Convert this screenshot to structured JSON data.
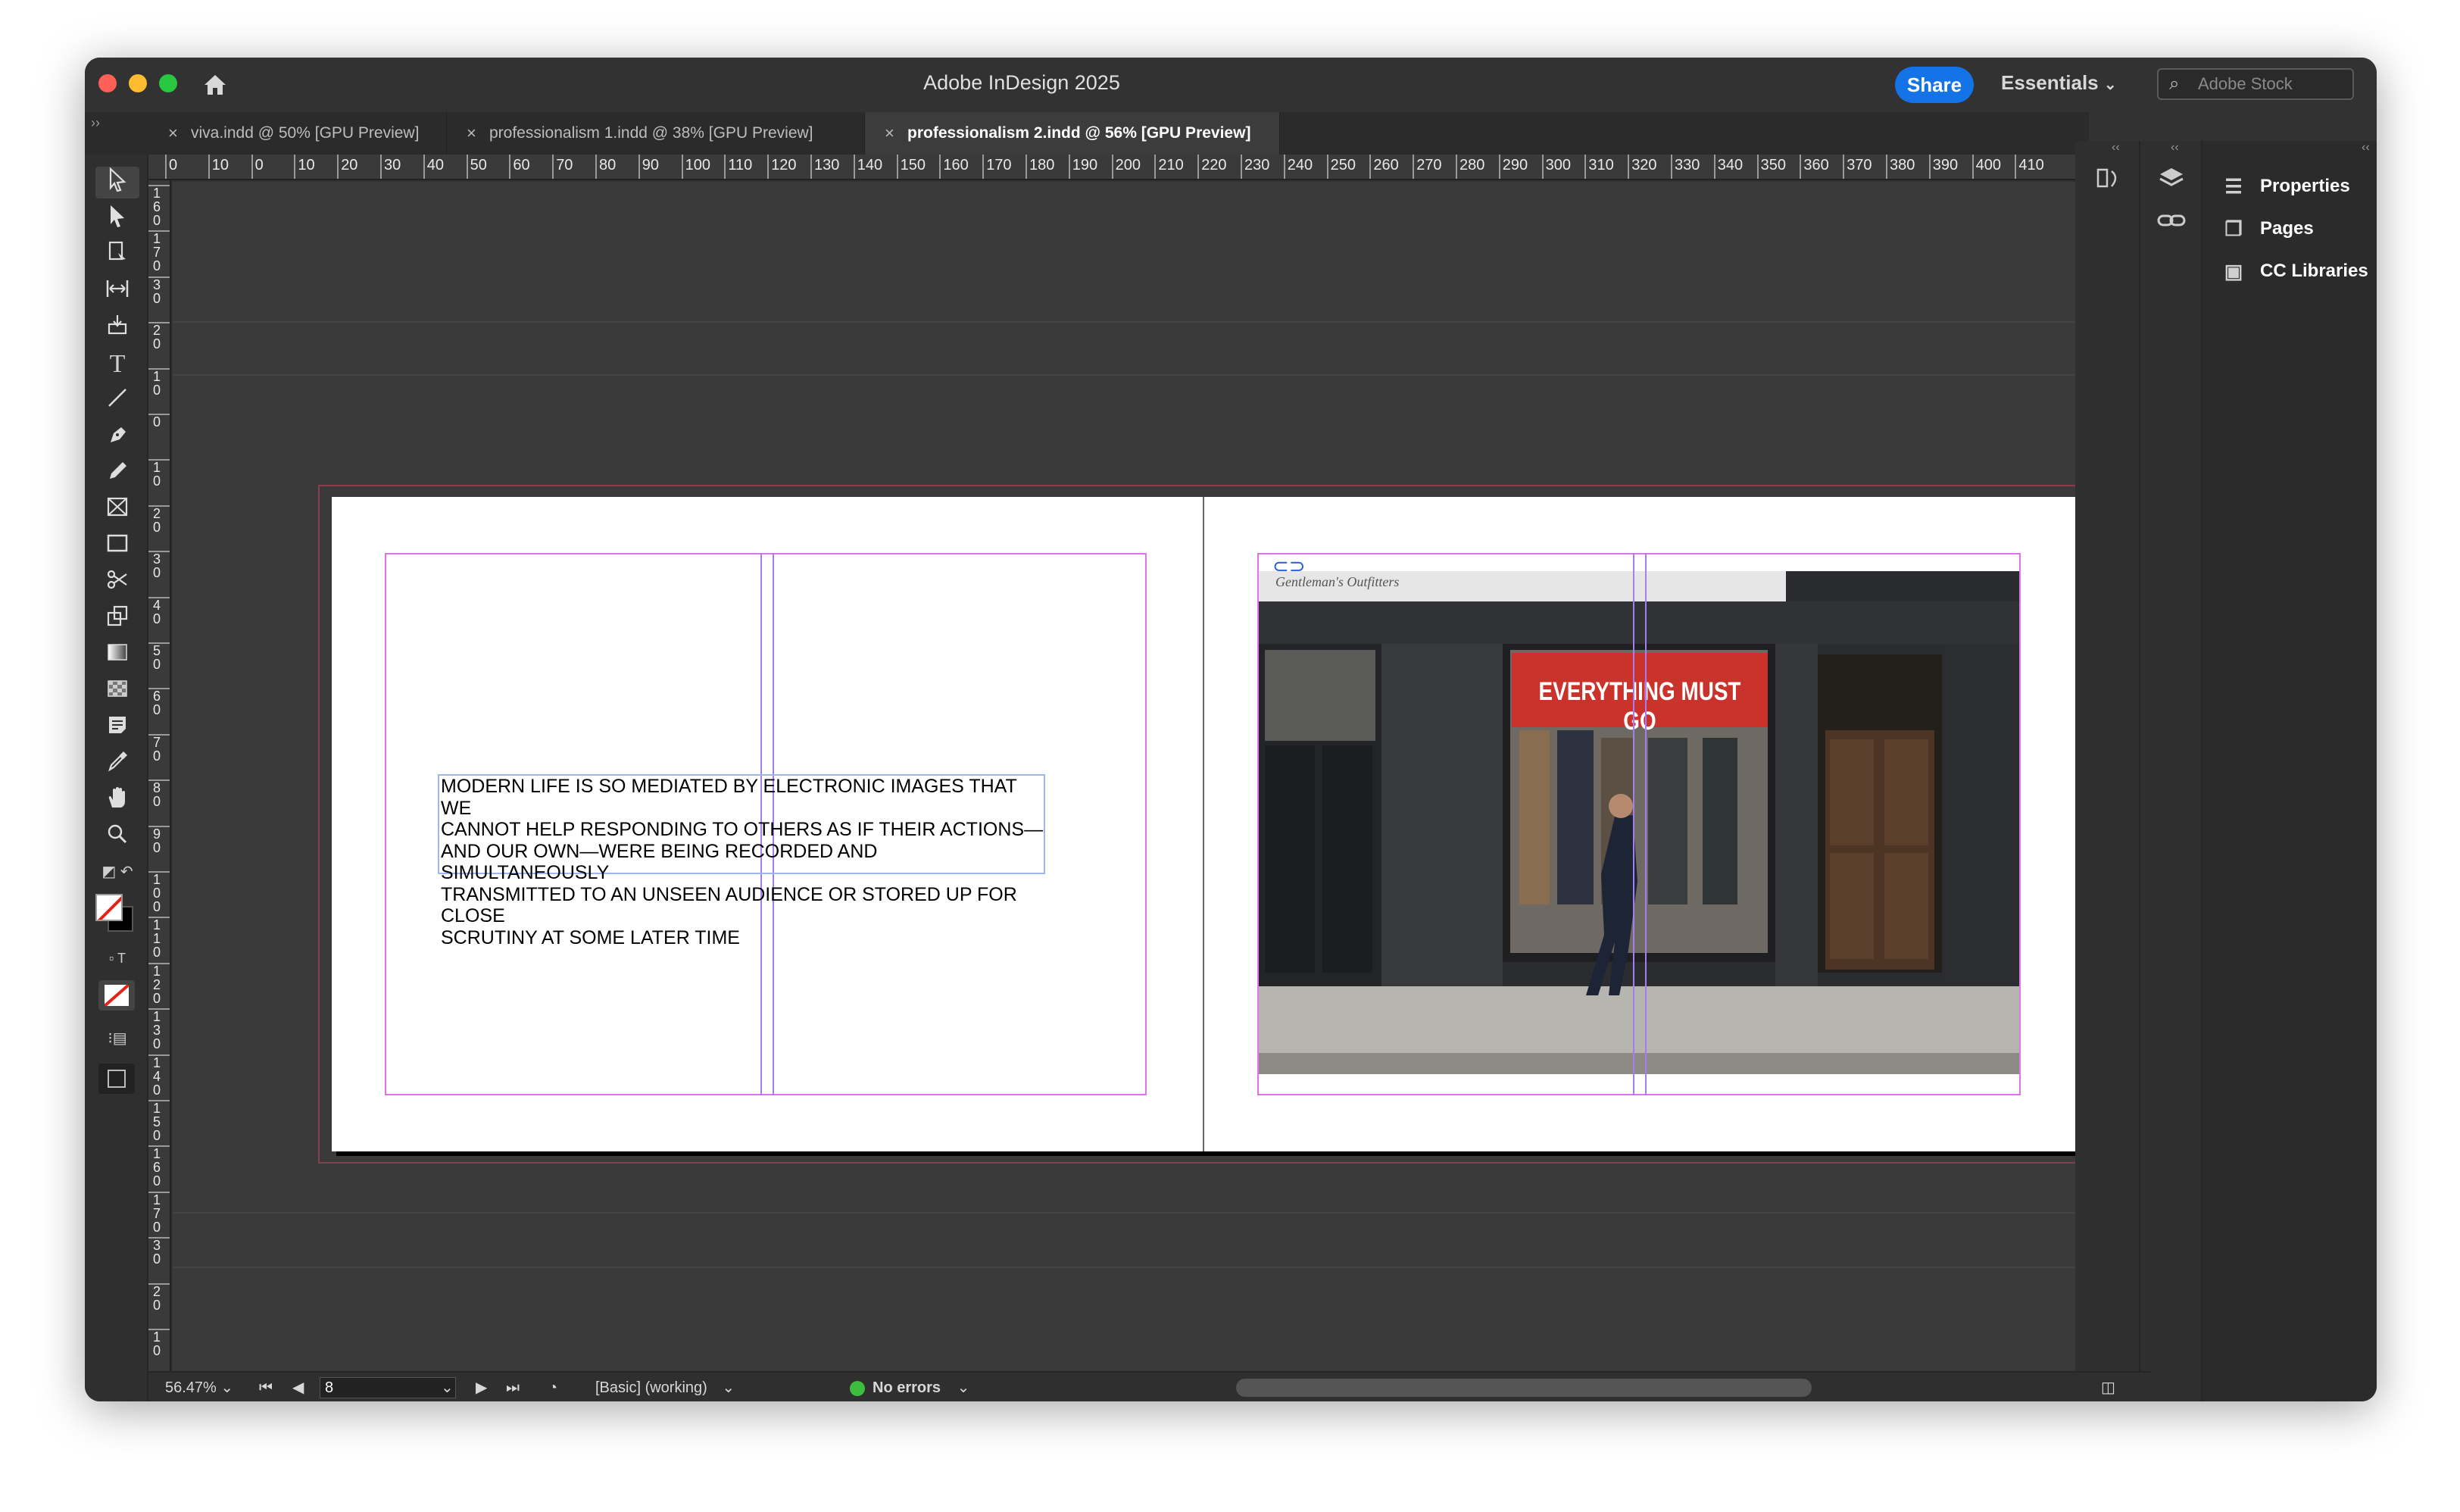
{
  "app": {
    "title": "Adobe InDesign 2025",
    "share_label": "Share",
    "workspace": "Essentials",
    "search_placeholder": "Adobe Stock"
  },
  "tabs": [
    {
      "label": "viva.indd @ 50% [GPU Preview]",
      "active": false
    },
    {
      "label": "professionalism 1.indd @ 38% [GPU Preview]",
      "active": false
    },
    {
      "label": "professionalism 2.indd @ 56% [GPU Preview]",
      "active": true
    }
  ],
  "tools": [
    "selection-tool",
    "direct-selection-tool",
    "page-tool",
    "gap-tool",
    "content-collector-tool",
    "type-tool",
    "line-tool",
    "pen-tool",
    "pencil-tool",
    "rectangle-frame-tool",
    "rectangle-tool",
    "scissors-tool",
    "free-transform-tool",
    "gradient-swatch-tool",
    "gradient-feather-tool",
    "note-tool",
    "eyedropper-tool",
    "hand-tool",
    "zoom-tool"
  ],
  "ruler": {
    "h_labels": [
      "0",
      "10",
      "0",
      "10",
      "20",
      "30",
      "40",
      "50",
      "60",
      "70",
      "80",
      "90",
      "100",
      "110",
      "120",
      "130",
      "140",
      "150",
      "160",
      "170",
      "180",
      "190",
      "200",
      "210",
      "220",
      "230",
      "240",
      "250",
      "260",
      "270",
      "280",
      "290",
      "300",
      "310",
      "320",
      "330",
      "340",
      "350",
      "360",
      "370",
      "380",
      "390",
      "400",
      "410"
    ],
    "v_labels": [
      "160",
      "170",
      "30",
      "20",
      "10",
      "0",
      "10",
      "20",
      "30",
      "40",
      "50",
      "60",
      "70",
      "80",
      "90",
      "100",
      "110",
      "120",
      "130",
      "140",
      "150",
      "160",
      "170",
      "30",
      "20",
      "10"
    ]
  },
  "document": {
    "body_text": "MODERN LIFE IS SO MEDIATED BY ELECTRONIC IMAGES THAT WE\nCANNOT HELP RESPONDING TO OTHERS AS IF THEIR ACTIONS—\nAND OUR OWN—WERE BEING RECORDED AND SIMULTANEOUSLY\nTRANSMITTED TO AN UNSEEN AUDIENCE OR STORED UP FOR CLOSE\nSCRUTINY AT SOME LATER TIME",
    "photo": {
      "shop_sign": "Gentleman's Outfitters",
      "banner": "EVERYTHING MUST GO"
    }
  },
  "panels": [
    {
      "label": "Properties",
      "icon": "sliders-icon"
    },
    {
      "label": "Pages",
      "icon": "pages-icon"
    },
    {
      "label": "CC Libraries",
      "icon": "cc-libraries-icon"
    }
  ],
  "status": {
    "zoom": "56.47%",
    "page": "8",
    "preflight_profile": "[Basic] (working)",
    "errors": "No errors",
    "status_color": "#3dbd3d"
  }
}
